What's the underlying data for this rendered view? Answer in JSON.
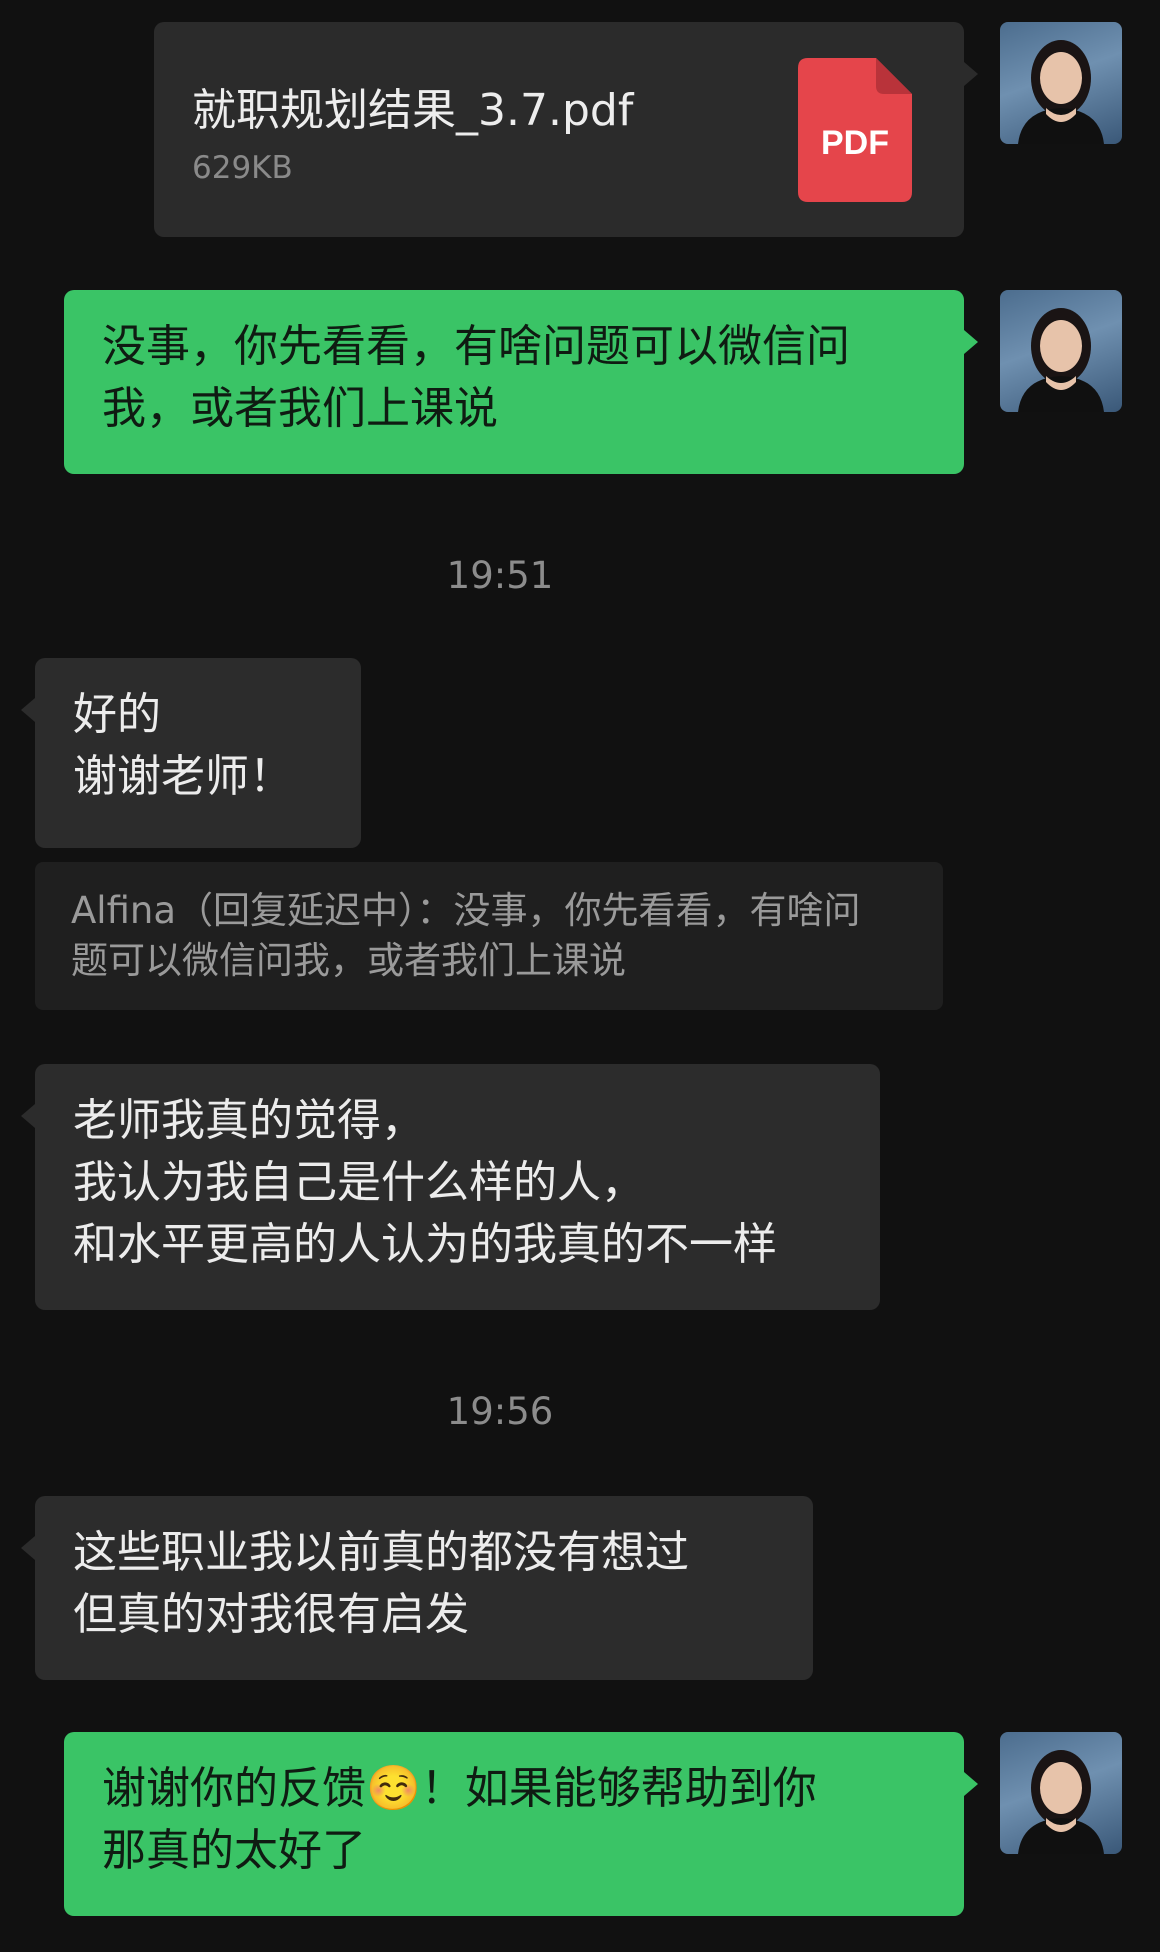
{
  "chat": {
    "file_message": {
      "file_name": "就职规划结果_3.7.pdf",
      "file_size": "629KB",
      "file_type_label": "PDF",
      "icon": "pdf-file-icon",
      "icon_color": "#e5454b"
    },
    "messages": {
      "m1": "没事，你先看看，有啥问题可以微信问\n我，或者我们上课说",
      "m2": "好的\n谢谢老师！",
      "m3": "老师我真的觉得，\n我认为我自己是什么样的人，\n和水平更高的人认为的我真的不一样",
      "m4": "这些职业我以前真的都没有想过\n但真的对我很有启发",
      "m5": "谢谢你的反馈☺️！如果能够帮助到你\n那真的太好了"
    },
    "quote": {
      "text": "Alfina（回复延迟中）：没事，你先看看，有啥问\n题可以微信问我，或者我们上课说"
    },
    "timestamps": {
      "t1": "19:51",
      "t2": "19:56"
    },
    "colors": {
      "sent_bubble": "#3ac466",
      "received_bubble": "#2c2c2c",
      "background": "#111111"
    }
  }
}
